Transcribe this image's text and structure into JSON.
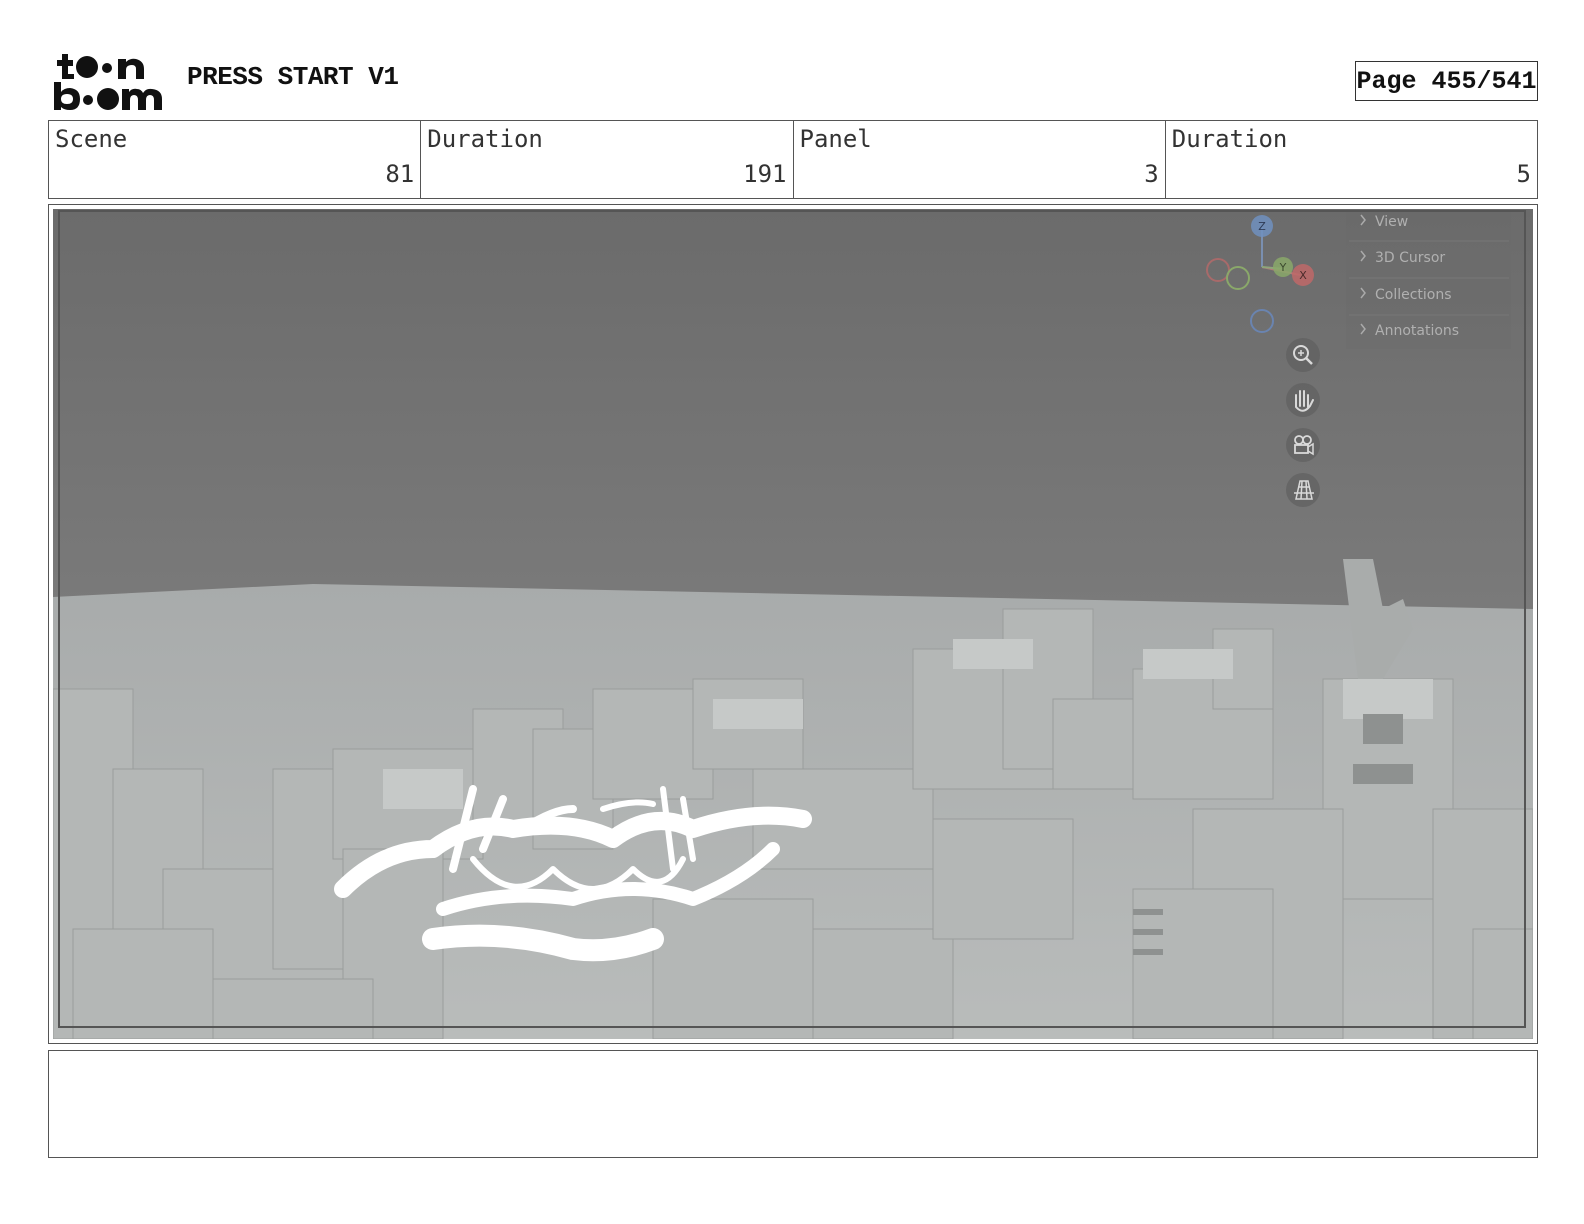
{
  "header": {
    "logo_text": "toon boom",
    "project_title": "PRESS START V1",
    "page_label": "Page 455/541"
  },
  "info": [
    {
      "label": "Scene",
      "value": "81"
    },
    {
      "label": "Duration",
      "value": "191"
    },
    {
      "label": "Panel",
      "value": "3"
    },
    {
      "label": "Duration",
      "value": "5"
    }
  ],
  "viewport": {
    "gizmo_axes": [
      "Z",
      "Y",
      "X"
    ],
    "side_panel": [
      "View",
      "3D Cursor",
      "Collections",
      "Annotations"
    ],
    "tools": [
      "zoom-icon",
      "hand-pan-icon",
      "camera-icon",
      "grid-icon"
    ]
  },
  "notes": {
    "text": ""
  }
}
